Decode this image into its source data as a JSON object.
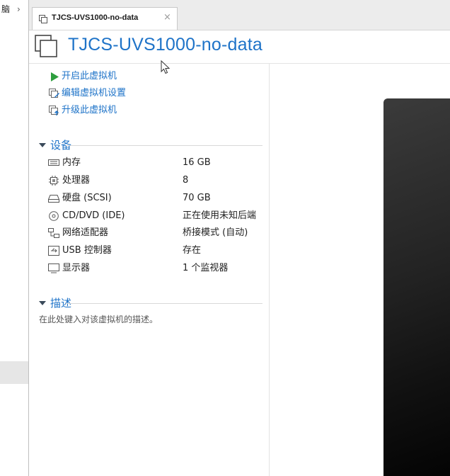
{
  "left_pane": {
    "item_text": "脑",
    "chevron": "›"
  },
  "tab": {
    "label": "TJCS-UVS1000-no-data",
    "close": "×",
    "icon": "vm-icon"
  },
  "header": {
    "title": "TJCS-UVS1000-no-data",
    "icon": "vm-icon"
  },
  "actions": [
    {
      "label": "开启此虚拟机",
      "icon": "play-icon"
    },
    {
      "label": "编辑虚拟机设置",
      "icon": "edit-settings-icon"
    },
    {
      "label": "升级此虚拟机",
      "icon": "upgrade-icon"
    }
  ],
  "devices_section": {
    "title": "设备",
    "items": [
      {
        "name": "内存",
        "value": "16 GB",
        "icon": "memory-icon"
      },
      {
        "name": "处理器",
        "value": "8",
        "icon": "cpu-icon"
      },
      {
        "name": "硬盘 (SCSI)",
        "value": "70 GB",
        "icon": "hard-disk-icon"
      },
      {
        "name": "CD/DVD (IDE)",
        "value": "正在使用未知后端",
        "icon": "cd-dvd-icon"
      },
      {
        "name": "网络适配器",
        "value": "桥接模式 (自动)",
        "icon": "network-adapter-icon"
      },
      {
        "name": "USB 控制器",
        "value": "存在",
        "icon": "usb-icon"
      },
      {
        "name": "显示器",
        "value": "1 个监视器",
        "icon": "display-icon"
      }
    ]
  },
  "description_section": {
    "title": "描述",
    "placeholder": "在此处键入对该虚拟机的描述。"
  },
  "colors": {
    "accent": "#1e73c8",
    "play_green": "#2e9e3e",
    "preview_dark": "#1a1a1a"
  }
}
